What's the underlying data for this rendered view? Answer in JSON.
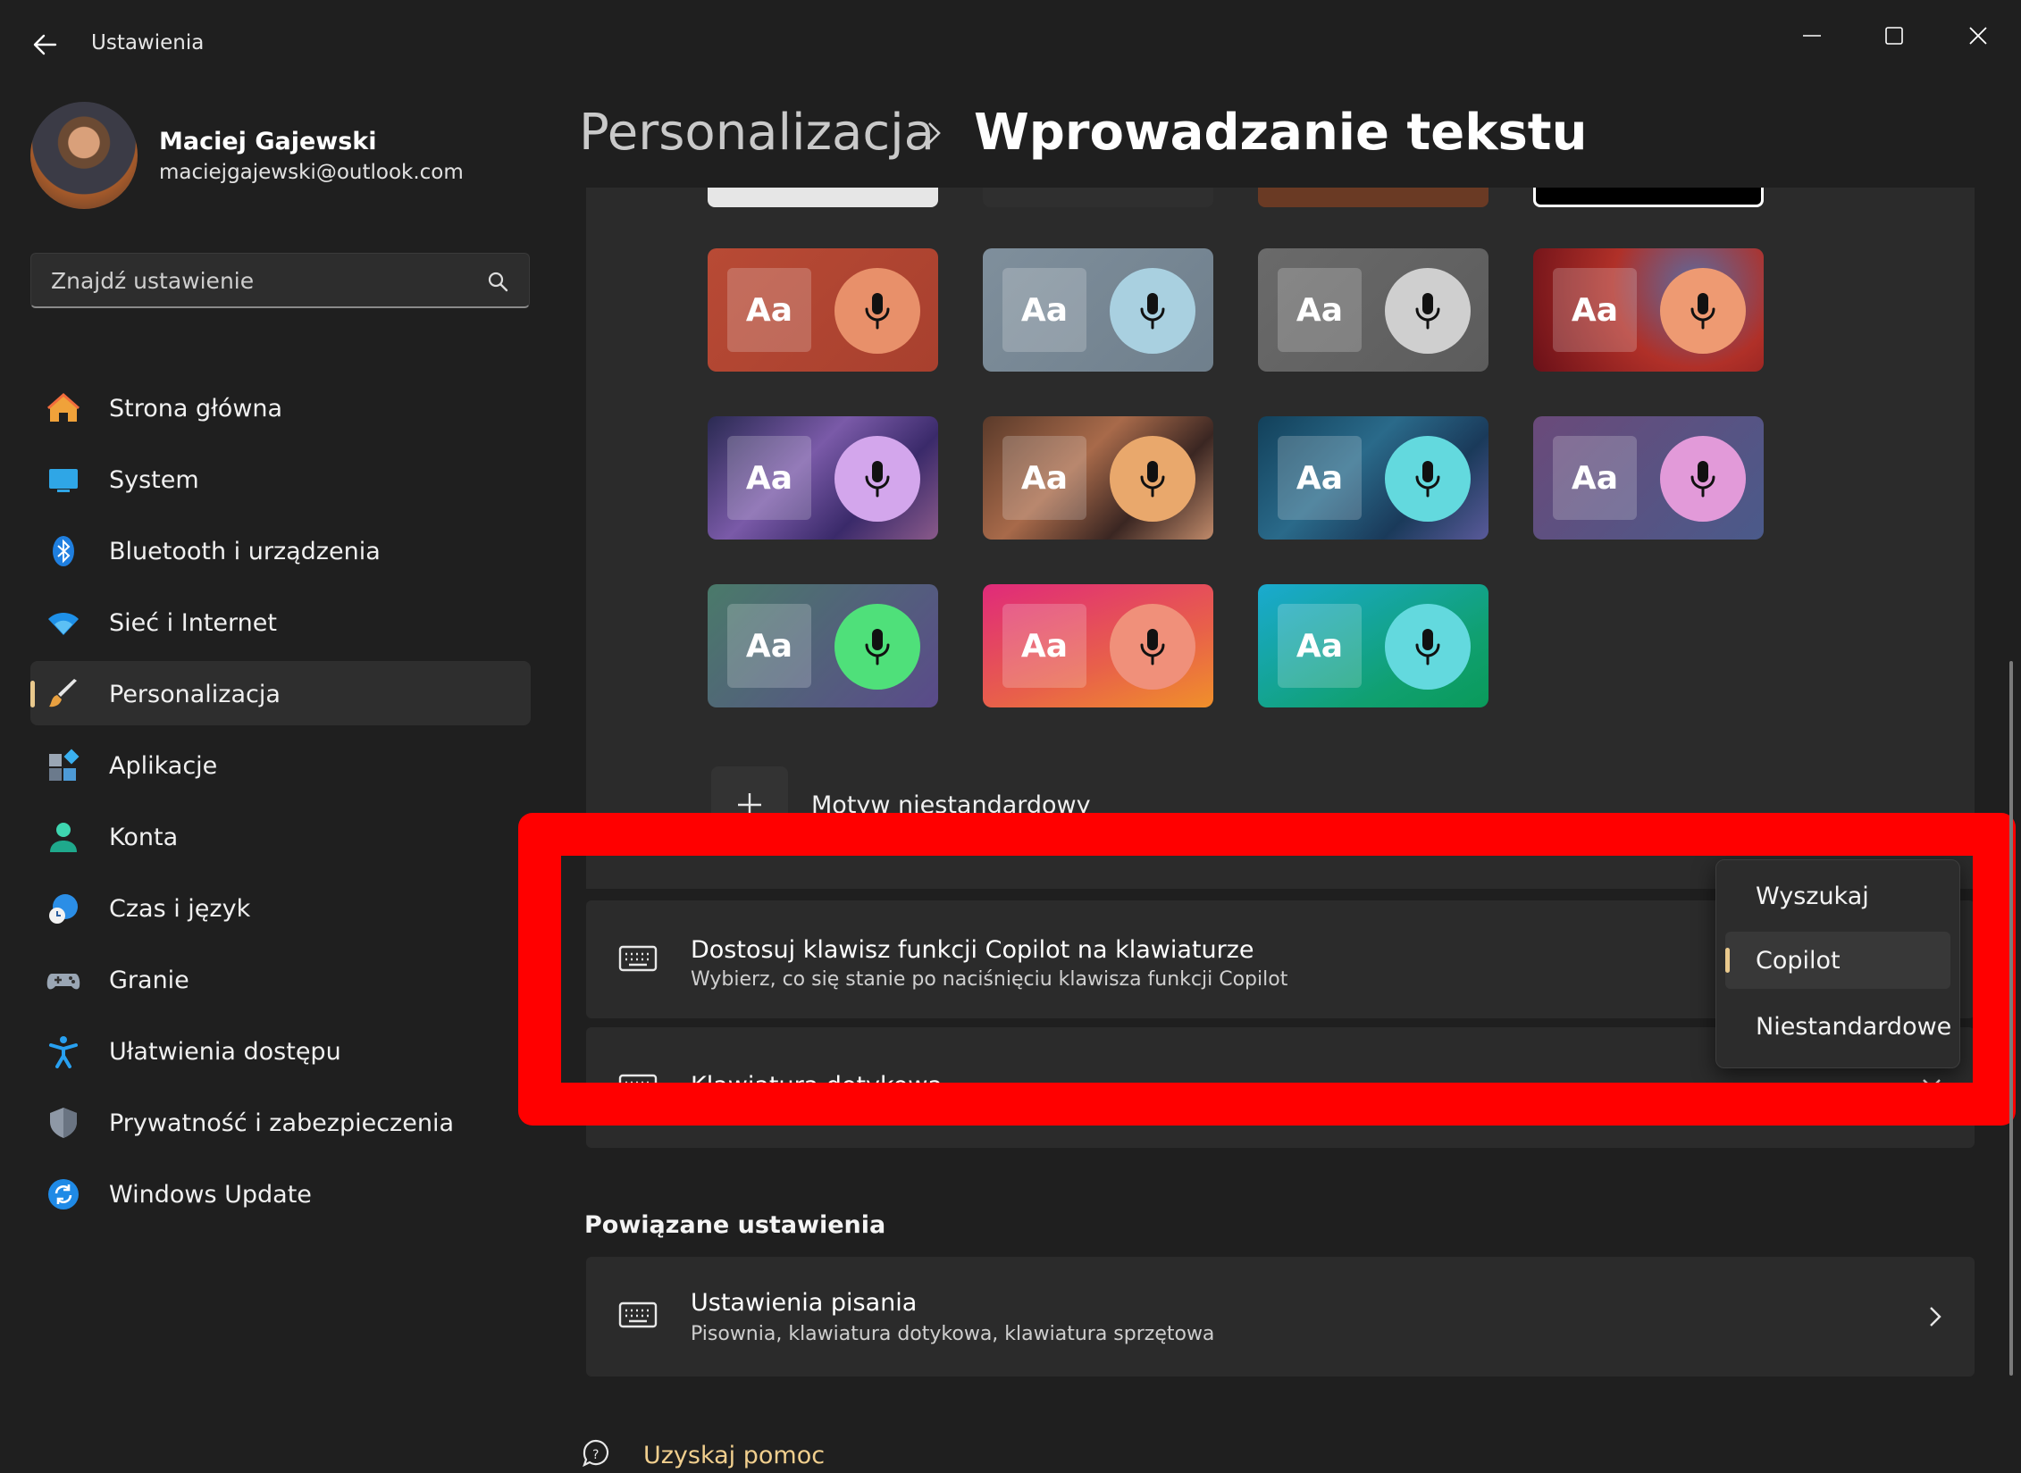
{
  "window": {
    "title": "Ustawienia"
  },
  "user": {
    "name": "Maciej Gajewski",
    "email": "maciejgajewski@outlook.com"
  },
  "search": {
    "placeholder": "Znajdź ustawienie"
  },
  "nav": [
    {
      "label": "Strona główna",
      "icon": "home-icon"
    },
    {
      "label": "System",
      "icon": "monitor-icon"
    },
    {
      "label": "Bluetooth i urządzenia",
      "icon": "bluetooth-icon"
    },
    {
      "label": "Sieć i Internet",
      "icon": "wifi-icon"
    },
    {
      "label": "Personalizacja",
      "icon": "brush-icon",
      "active": true
    },
    {
      "label": "Aplikacje",
      "icon": "apps-icon"
    },
    {
      "label": "Konta",
      "icon": "person-icon"
    },
    {
      "label": "Czas i język",
      "icon": "globe-clock-icon"
    },
    {
      "label": "Granie",
      "icon": "gamepad-icon"
    },
    {
      "label": "Ułatwienia dostępu",
      "icon": "accessibility-icon"
    },
    {
      "label": "Prywatność i zabezpieczenia",
      "icon": "shield-icon"
    },
    {
      "label": "Windows Update",
      "icon": "update-icon"
    }
  ],
  "breadcrumb": {
    "parent": "Personalizacja",
    "current": "Wprowadzanie tekstu"
  },
  "themes": {
    "tile_text": "Aa",
    "custom_label": "Motyw niestandardowy",
    "tiles": [
      {
        "bg": "linear-gradient(135deg,#b84a35,#a8402e)",
        "mic": "#e8906a"
      },
      {
        "bg": "linear-gradient(135deg,#7f8f9c,#6f7f8c)",
        "mic": "#a9d0e0"
      },
      {
        "bg": "linear-gradient(135deg,#6a6a6a,#5c5c5c)",
        "mic": "#cfcfcf"
      },
      {
        "bg": "radial-gradient(circle at 70% 30%,#5d6a9e 0%,#b03028 45%,#6a1018 100%)",
        "mic": "#ee9a72"
      },
      {
        "bg": "linear-gradient(135deg,#2a2a52,#7a5aa8 40%,#3a2a6a 70%,#8a5a8a)",
        "mic": "#d3a6ec"
      },
      {
        "bg": "linear-gradient(135deg,#5a3a2a,#a86a4a 40%,#3a2622 70%,#c08a6a)",
        "mic": "#e9a86c"
      },
      {
        "bg": "linear-gradient(135deg,#12405a,#2a6a8a 40%,#1a3a5a 70%,#5a5a9a)",
        "mic": "#63d9de"
      },
      {
        "bg": "linear-gradient(135deg,#6a4a7a,#4a5a8a)",
        "mic": "#e29ad9"
      },
      {
        "bg": "linear-gradient(135deg,#4a7a6a,#5a4a8a)",
        "mic": "#4fe07a"
      },
      {
        "bg": "linear-gradient(160deg,#e02a7a,#e8604a 60%,#f0902a)",
        "mic": "#f0907a"
      },
      {
        "bg": "linear-gradient(150deg,#1aaad0,#10a070 70%,#0a9a5a)",
        "mic": "#63d9de"
      }
    ]
  },
  "copilot_row": {
    "title": "Dostosuj klawisz funkcji Copilot na klawiaturze",
    "subtitle": "Wybierz, co się stanie po naciśnięciu klawisza funkcji Copilot"
  },
  "touch_keyboard_row": {
    "title": "Klawiatura dotykowa"
  },
  "dropdown": {
    "options": [
      "Wyszukaj",
      "Copilot",
      "Niestandardowe"
    ],
    "selected": "Copilot"
  },
  "related": {
    "heading": "Powiązane ustawienia",
    "items": [
      {
        "title": "Ustawienia pisania",
        "subtitle": "Pisownia, klawiatura dotykowa, klawiatura sprzętowa"
      }
    ]
  },
  "help": {
    "label": "Uzyskaj pomoc"
  },
  "colors": {
    "accent": "#e9c98d",
    "highlight": "#ff0000",
    "link": "#f1cf8e"
  }
}
